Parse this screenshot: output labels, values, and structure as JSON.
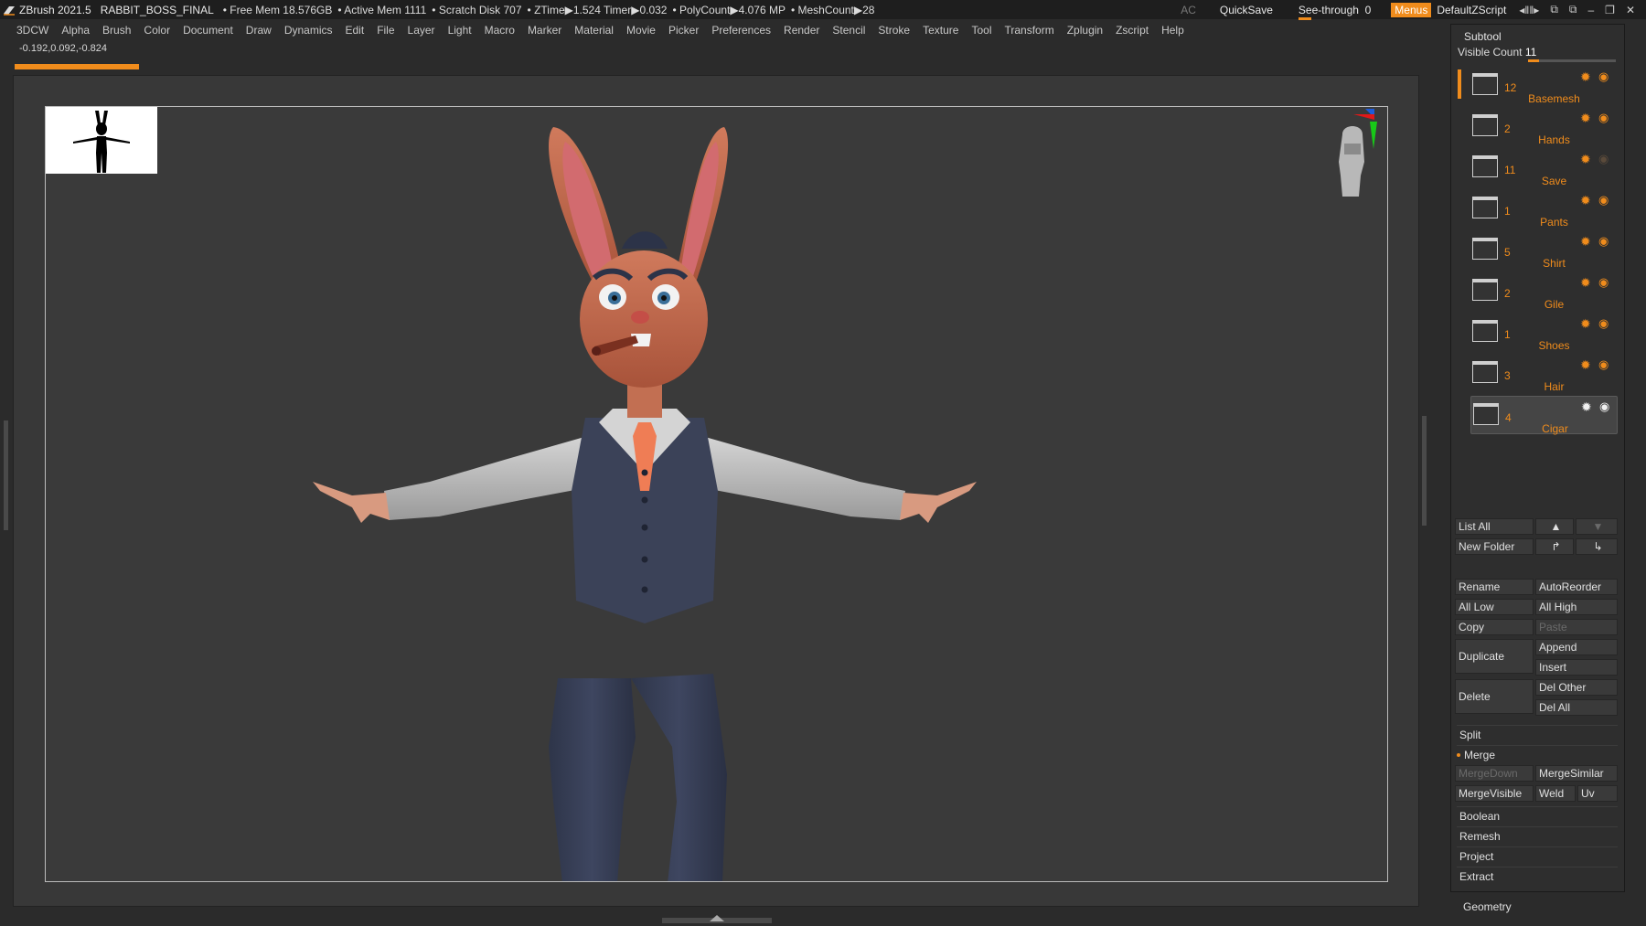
{
  "titlebar": {
    "app": "ZBrush 2021.5",
    "file": "RABBIT_BOSS_FINAL",
    "free_mem": "• Free Mem 18.576GB",
    "active_mem": "• Active Mem 1111",
    "scratch": "• Scratch Disk 707",
    "ztime": "• ZTime▶1.524 Timer▶0.032",
    "polycount": "• PolyCount▶4.076 MP",
    "meshcount": "• MeshCount▶28",
    "ac": "AC",
    "quicksave": "QuickSave",
    "see_through": "See-through",
    "see_through_value": "0",
    "menus": "Menus",
    "default_zscript": "DefaultZScript"
  },
  "menubar": [
    "3DCW",
    "Alpha",
    "Brush",
    "Color",
    "Document",
    "Draw",
    "Dynamics",
    "Edit",
    "File",
    "Layer",
    "Light",
    "Macro",
    "Marker",
    "Material",
    "Movie",
    "Picker",
    "Preferences",
    "Render",
    "Stencil",
    "Stroke",
    "Texture",
    "Tool",
    "Transform",
    "Zplugin",
    "Zscript",
    "Help"
  ],
  "coords": "-0.192,0.092,-0.824",
  "subtool": {
    "title": "Subtool",
    "visible_count_label": "Visible Count",
    "visible_count": "11",
    "items": [
      {
        "count": "12",
        "name": "Basemesh",
        "visible": true
      },
      {
        "count": "2",
        "name": "Hands",
        "visible": true
      },
      {
        "count": "11",
        "name": "Save",
        "visible": false
      },
      {
        "count": "1",
        "name": "Pants",
        "visible": true
      },
      {
        "count": "5",
        "name": "Shirt",
        "visible": true
      },
      {
        "count": "2",
        "name": "Gile",
        "visible": true
      },
      {
        "count": "1",
        "name": "Shoes",
        "visible": true
      },
      {
        "count": "3",
        "name": "Hair",
        "visible": true
      },
      {
        "count": "4",
        "name": "Cigar",
        "visible": true,
        "selected": true
      }
    ]
  },
  "buttons": {
    "list_all": "List All",
    "new_folder": "New Folder",
    "rename": "Rename",
    "autoreorder": "AutoReorder",
    "all_low": "All Low",
    "all_high": "All High",
    "copy": "Copy",
    "paste": "Paste",
    "duplicate": "Duplicate",
    "append": "Append",
    "insert": "Insert",
    "delete": "Delete",
    "del_other": "Del Other",
    "del_all": "Del All",
    "split": "Split",
    "merge": "Merge",
    "mergedown": "MergeDown",
    "mergesimilar": "MergeSimilar",
    "mergevisible": "MergeVisible",
    "weld": "Weld",
    "uv": "Uv",
    "boolean": "Boolean",
    "remesh": "Remesh",
    "project": "Project",
    "extract": "Extract",
    "geometry": "Geometry"
  },
  "colors": {
    "accent": "#f08c1c",
    "panel": "#2e2e2e",
    "viewport": "#3a3a3a"
  }
}
